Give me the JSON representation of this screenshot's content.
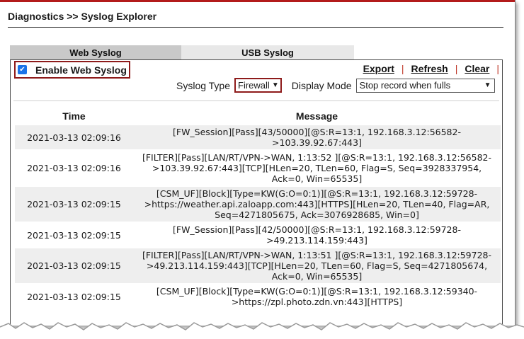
{
  "breadcrumb": "Diagnostics >> Syslog Explorer",
  "tabs": [
    {
      "label": "Web Syslog",
      "active": true
    },
    {
      "label": "USB Syslog",
      "active": false
    }
  ],
  "enable": {
    "label": "Enable Web Syslog",
    "checked": true
  },
  "actions": {
    "export": "Export",
    "refresh": "Refresh",
    "clear": "Clear",
    "separator": "|"
  },
  "syslog_type": {
    "label": "Syslog Type",
    "value": "Firewall"
  },
  "display_mode": {
    "label": "Display Mode",
    "value": "Stop record when fulls"
  },
  "table": {
    "headers": {
      "time": "Time",
      "message": "Message"
    },
    "rows": [
      {
        "time": "2021-03-13 02:09:16",
        "message": "[FW_Session][Pass][43/50000][@S:R=13:1, 192.168.3.12:56582->103.39.92.67:443]"
      },
      {
        "time": "2021-03-13 02:09:16",
        "message": "[FILTER][Pass][LAN/RT/VPN->WAN, 1:13:52 ][@S:R=13:1, 192.168.3.12:56582->103.39.92.67:443][TCP][HLen=20, TLen=60, Flag=S, Seq=3928337954, Ack=0, Win=65535]"
      },
      {
        "time": "2021-03-13 02:09:15",
        "message": "[CSM_UF][Block][Type=KW(G:O=0:1)][@S:R=13:1, 192.168.3.12:59728->https://weather.api.zaloapp.com:443][HTTPS][HLen=20, TLen=40, Flag=AR, Seq=4271805675, Ack=3076928685, Win=0]"
      },
      {
        "time": "2021-03-13 02:09:15",
        "message": "[FW_Session][Pass][42/50000][@S:R=13:1, 192.168.3.12:59728->49.213.114.159:443]"
      },
      {
        "time": "2021-03-13 02:09:15",
        "message": "[FILTER][Pass][LAN/RT/VPN->WAN, 1:13:51 ][@S:R=13:1, 192.168.3.12:59728->49.213.114.159:443][TCP][HLen=20, TLen=60, Flag=S, Seq=4271805674, Ack=0, Win=65535]"
      },
      {
        "time": "2021-03-13 02:09:15",
        "message": "[CSM_UF][Block][Type=KW(G:O=0:1)][@S:R=13:1, 192.168.3.12:59340->https://zpl.photo.zdn.vn:443][HTTPS]"
      }
    ]
  }
}
